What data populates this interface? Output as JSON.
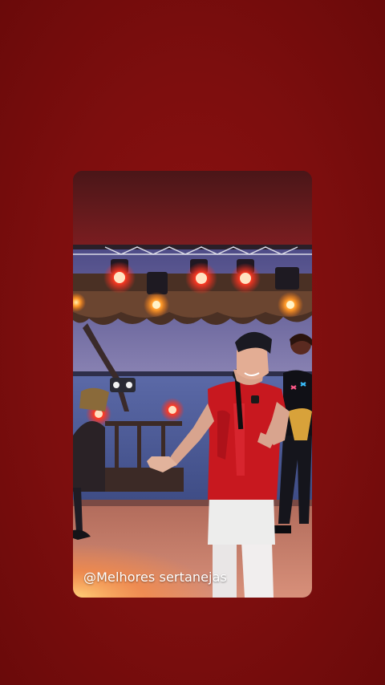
{
  "story": {
    "background_color": "#7d0e0e",
    "video": {
      "watermark": "@Melhores sertanejas"
    }
  },
  "colors": {
    "stage_light_red": "#ff2a1e",
    "shirt_red": "#c8181f",
    "sky_dusk": "#6c6aa0"
  }
}
